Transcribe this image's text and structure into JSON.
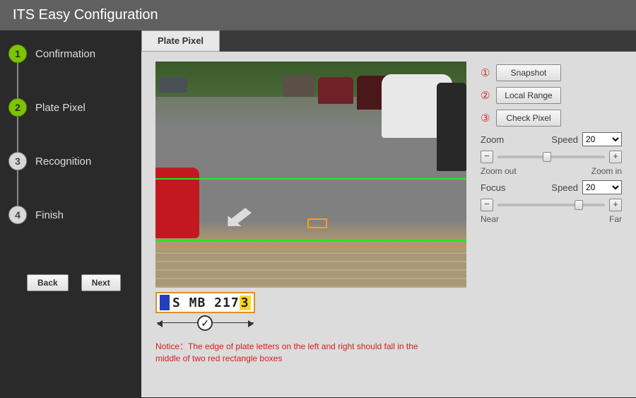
{
  "header": {
    "title": "ITS Easy Configuration"
  },
  "sidebar": {
    "steps": [
      {
        "num": "1",
        "label": "Confirmation",
        "state": "done"
      },
      {
        "num": "2",
        "label": "Plate Pixel",
        "state": "active"
      },
      {
        "num": "3",
        "label": "Recognition",
        "state": "pending"
      },
      {
        "num": "4",
        "label": "Finish",
        "state": "pending"
      }
    ],
    "back_label": "Back",
    "next_label": "Next"
  },
  "tab": {
    "label": "Plate Pixel"
  },
  "plate_sample": {
    "text": "S MB 217",
    "last_char": "3"
  },
  "notice": "Notice：The edge of plate letters on the left and right should fall in the middle of two red rectangle boxes",
  "controls": {
    "btn1": {
      "num": "①",
      "label": "Snapshot"
    },
    "btn2": {
      "num": "②",
      "label": "Local Range"
    },
    "btn3": {
      "num": "③",
      "label": "Check Pixel"
    },
    "zoom": {
      "label": "Zoom",
      "speed_label": "Speed",
      "speed_value": "20",
      "minus": "−",
      "plus": "+",
      "left": "Zoom out",
      "right": "Zoom in",
      "thumb_pos": "42%"
    },
    "focus": {
      "label": "Focus",
      "speed_label": "Speed",
      "speed_value": "20",
      "minus": "−",
      "plus": "+",
      "left": "Near",
      "right": "Far",
      "thumb_pos": "72%"
    }
  }
}
